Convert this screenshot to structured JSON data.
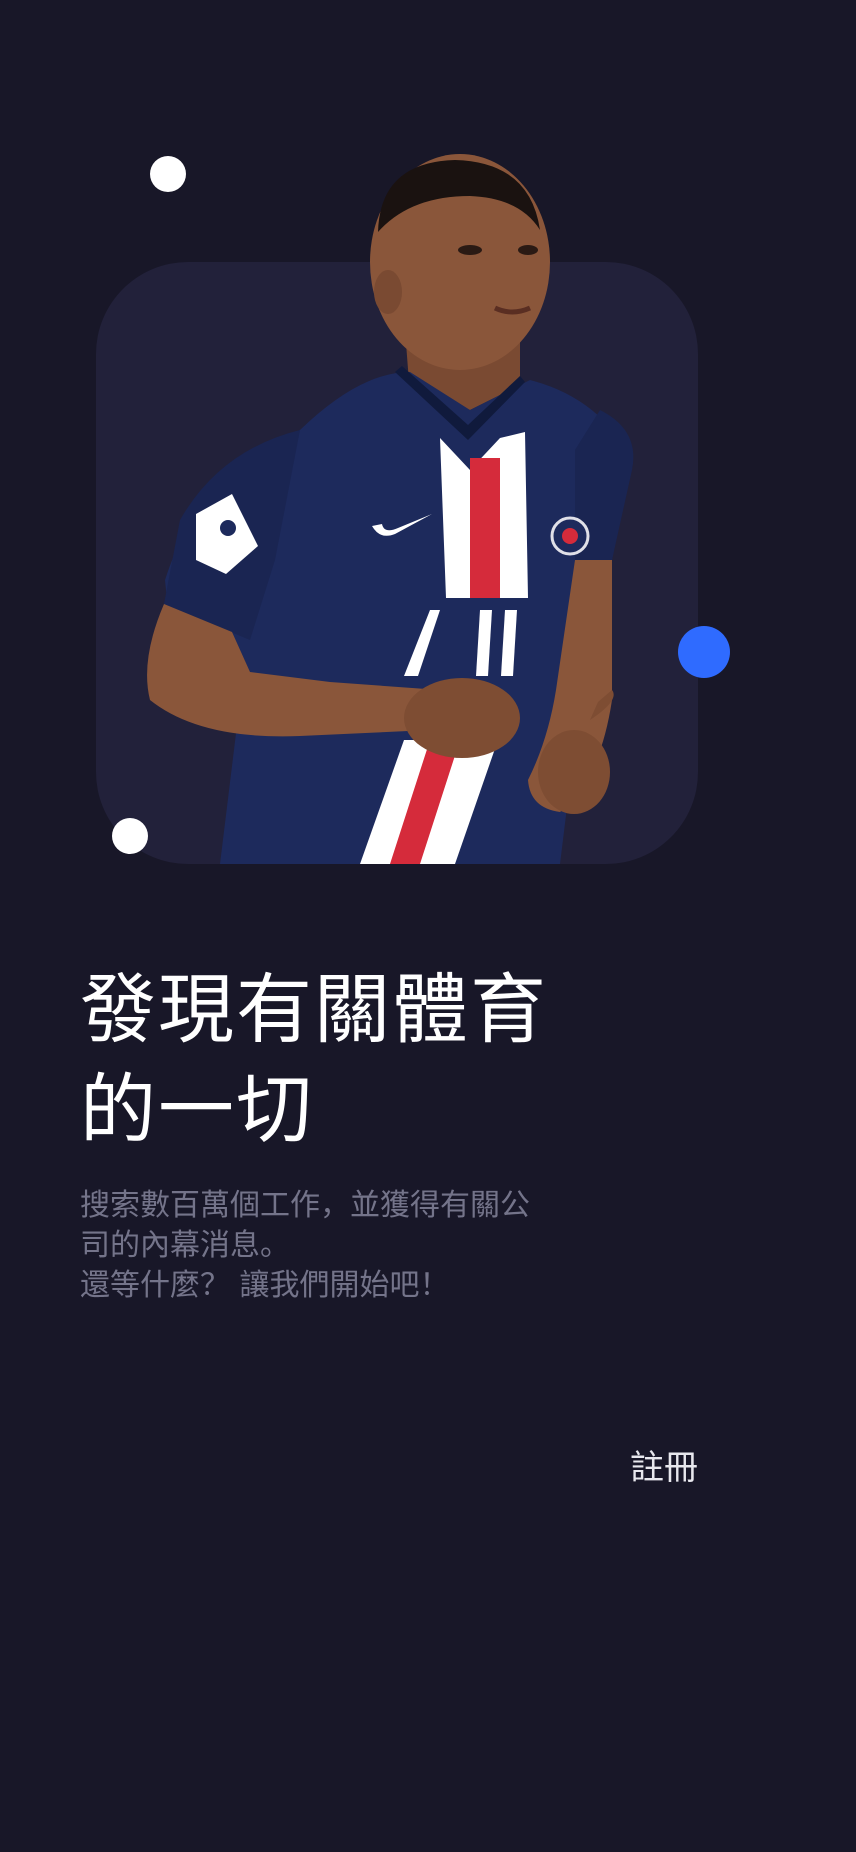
{
  "hero": {
    "illustration": "soccer-player-icon",
    "colors": {
      "background": "#181728",
      "card": "#22213a",
      "accent_dot": "#2f6bff",
      "jersey": "#1d2a5c",
      "stripe_red": "#d52b3b"
    }
  },
  "headline": {
    "line1": "發現有關體育",
    "line2": "的一切"
  },
  "subtext": {
    "line1": "搜索數百萬個工作，並獲得有關公",
    "line2": "司的內幕消息。",
    "line3": "還等什麼？ 讓我們開始吧！"
  },
  "actions": {
    "register_label": "註冊"
  }
}
